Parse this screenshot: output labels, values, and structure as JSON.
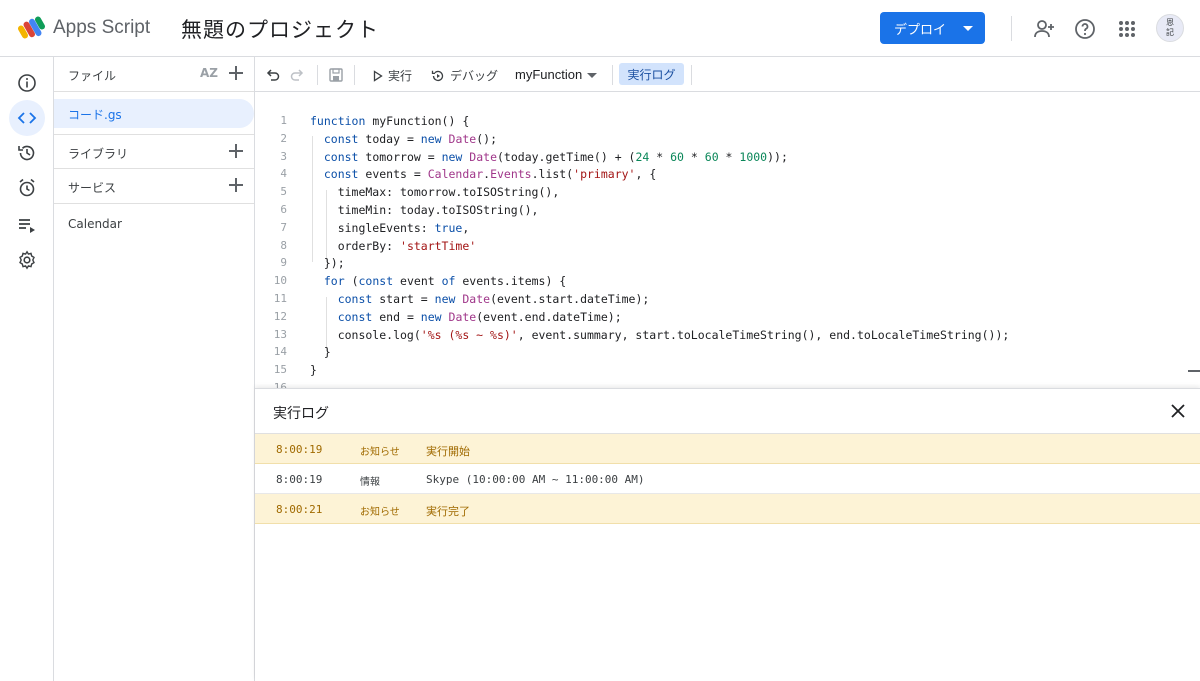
{
  "header": {
    "brand": "Apps Script",
    "project_title": "無題のプロジェクト",
    "deploy_label": "デプロイ",
    "avatar_text": "恩\n記",
    "icons": [
      "add-person-icon",
      "help-icon",
      "apps-grid-icon"
    ]
  },
  "rail": {
    "items": [
      "info-icon",
      "code-icon",
      "history-icon",
      "trigger-clock-icon",
      "executions-icon",
      "settings-icon"
    ],
    "active": "code-icon"
  },
  "files_panel": {
    "files_label": "ファイル",
    "sort_label": "AZ",
    "active_file": "コード.gs",
    "libraries_label": "ライブラリ",
    "services_label": "サービス",
    "services": [
      "Calendar"
    ]
  },
  "toolbar": {
    "run_label": "実行",
    "debug_label": "デバッグ",
    "function_name": "myFunction",
    "exec_log_label": "実行ログ"
  },
  "editor": {
    "lines": [
      {
        "n": "1",
        "text": "function myFunction() {"
      },
      {
        "n": "2",
        "text": "  const today = new Date();"
      },
      {
        "n": "3",
        "text": "  const tomorrow = new Date(today.getTime() + (24 * 60 * 60 * 1000));"
      },
      {
        "n": "4",
        "text": "  const events = Calendar.Events.list('primary', {"
      },
      {
        "n": "5",
        "text": "    timeMax: tomorrow.toISOString(),"
      },
      {
        "n": "6",
        "text": "    timeMin: today.toISOString(),"
      },
      {
        "n": "7",
        "text": "    singleEvents: true,"
      },
      {
        "n": "8",
        "text": "    orderBy: 'startTime'"
      },
      {
        "n": "9",
        "text": "  });"
      },
      {
        "n": "10",
        "text": "  for (const event of events.items) {"
      },
      {
        "n": "11",
        "text": "    const start = new Date(event.start.dateTime);"
      },
      {
        "n": "12",
        "text": "    const end = new Date(event.end.dateTime);"
      },
      {
        "n": "13",
        "text": "    console.log('%s (%s ~ %s)', event.summary, start.toLocaleTimeString(), end.toLocaleTimeString());"
      },
      {
        "n": "14",
        "text": "  }"
      },
      {
        "n": "15",
        "text": "}"
      },
      {
        "n": "16",
        "text": ""
      }
    ]
  },
  "log_panel": {
    "title": "実行ログ",
    "rows": [
      {
        "time": "8:00:19",
        "level": "お知らせ",
        "message": "実行開始",
        "kind": "notice"
      },
      {
        "time": "8:00:19",
        "level": "情報",
        "message": "Skype (10:00:00 AM ~ 11:00:00 AM)",
        "kind": "info"
      },
      {
        "time": "8:00:21",
        "level": "お知らせ",
        "message": "実行完了",
        "kind": "notice"
      }
    ]
  },
  "colors": {
    "accent": "#1a73e8",
    "notice_bg": "#fdf3d6",
    "notice_text": "#a06a00"
  }
}
